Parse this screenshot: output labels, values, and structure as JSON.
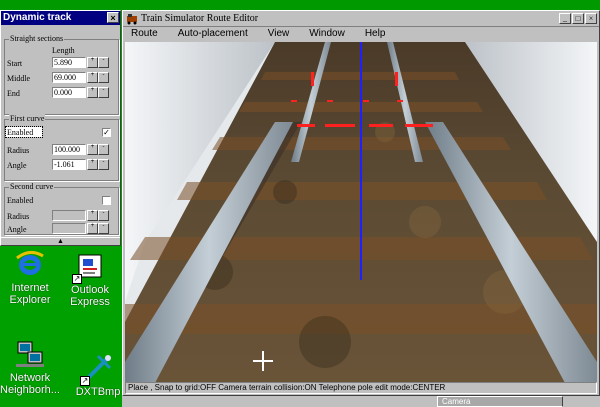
{
  "dynamic_track": {
    "title": "Dynamic track",
    "close": "×",
    "straight_sections": {
      "title": "Straight sections",
      "column_header": "Length",
      "rows": [
        {
          "label": "Start",
          "value": "5.890"
        },
        {
          "label": "Middle",
          "value": "69.000"
        },
        {
          "label": "End",
          "value": "0.000"
        }
      ]
    },
    "first_curve": {
      "title": "First curve",
      "enabled_label": "Enabled",
      "enabled_mark": "✓",
      "radius_label": "Radius",
      "radius_value": "100.000",
      "angle_label": "Angle",
      "angle_value": "-1.061"
    },
    "second_curve": {
      "title": "Second curve",
      "enabled_label": "Enabled",
      "radius_label": "Radius",
      "angle_label": "Angle"
    },
    "spin_plus": "+",
    "spin_minus": "-",
    "footer_arrow": "▲"
  },
  "desktop_icons": [
    {
      "label": "Internet Explorer",
      "icon": "internet-explorer-icon"
    },
    {
      "label": "Outlook Express",
      "icon": "outlook-express-icon"
    },
    {
      "label": "Network Neighborh...",
      "icon": "network-neighborhood-icon"
    },
    {
      "label": "DXTBmp",
      "icon": "dxtbmp-icon"
    }
  ],
  "editor": {
    "title": "Train Simulator Route Editor",
    "window_buttons": {
      "minimize": "_",
      "maximize": "□",
      "close": "×"
    },
    "menu": [
      "Route",
      "Auto-placement",
      "View",
      "Window",
      "Help"
    ],
    "status_text": "Place , Snap to grid:OFF Camera terrain collision:ON Telephone pole edit mode:CENTER"
  },
  "camera_window": {
    "title": "Camera"
  },
  "colors": {
    "desktop": "#00a000",
    "title_active": "#000080",
    "chrome": "#c0c0c0",
    "axis_blue": "#2020ff",
    "marker_red": "#ff2020",
    "rail": "#9aa7b0"
  }
}
